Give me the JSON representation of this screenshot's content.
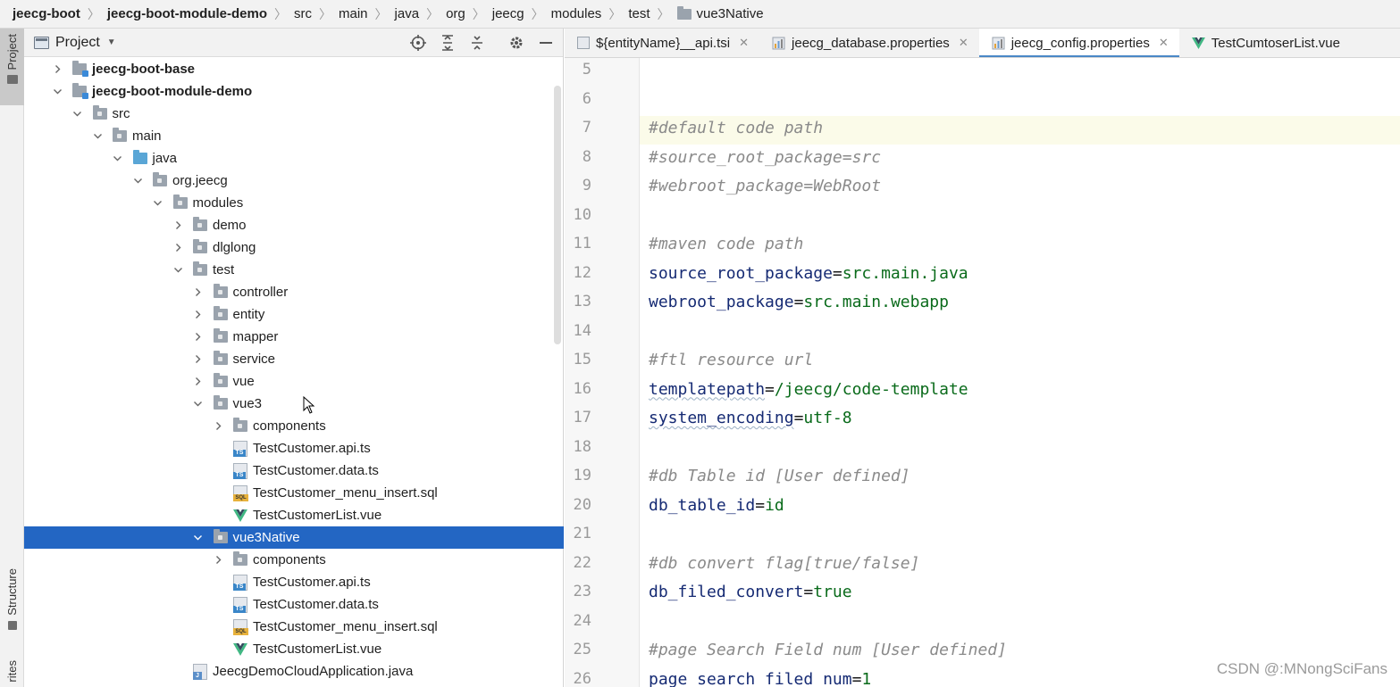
{
  "breadcrumb": [
    {
      "label": "jeecg-boot",
      "bold": true
    },
    {
      "label": "jeecg-boot-module-demo",
      "bold": true
    },
    {
      "label": "src"
    },
    {
      "label": "main"
    },
    {
      "label": "java"
    },
    {
      "label": "org"
    },
    {
      "label": "jeecg"
    },
    {
      "label": "modules"
    },
    {
      "label": "test"
    },
    {
      "label": "vue3Native",
      "folder": true
    }
  ],
  "tool_strip": {
    "project_label": "Project",
    "structure_label": "Structure",
    "favorites_label": "rites"
  },
  "project_panel": {
    "title": "Project",
    "tools": [
      "locate-icon",
      "expand-all-icon",
      "collapse-all-icon",
      "gear-icon",
      "minimize-icon"
    ]
  },
  "tree": [
    {
      "label": "jeecg-boot-base",
      "depth": 0,
      "chevron": "right",
      "icon": "module",
      "bold": true
    },
    {
      "label": "jeecg-boot-module-demo",
      "depth": 0,
      "chevron": "down",
      "icon": "module",
      "bold": true
    },
    {
      "label": "src",
      "depth": 1,
      "chevron": "down",
      "icon": "folder"
    },
    {
      "label": "main",
      "depth": 2,
      "chevron": "down",
      "icon": "folder"
    },
    {
      "label": "java",
      "depth": 3,
      "chevron": "down",
      "icon": "srcfolder"
    },
    {
      "label": "org.jeecg",
      "depth": 4,
      "chevron": "down",
      "icon": "folder"
    },
    {
      "label": "modules",
      "depth": 5,
      "chevron": "down",
      "icon": "folder"
    },
    {
      "label": "demo",
      "depth": 6,
      "chevron": "right",
      "icon": "folder"
    },
    {
      "label": "dlglong",
      "depth": 6,
      "chevron": "right",
      "icon": "folder"
    },
    {
      "label": "test",
      "depth": 6,
      "chevron": "down",
      "icon": "folder"
    },
    {
      "label": "controller",
      "depth": 7,
      "chevron": "right",
      "icon": "folder"
    },
    {
      "label": "entity",
      "depth": 7,
      "chevron": "right",
      "icon": "folder"
    },
    {
      "label": "mapper",
      "depth": 7,
      "chevron": "right",
      "icon": "folder"
    },
    {
      "label": "service",
      "depth": 7,
      "chevron": "right",
      "icon": "folder"
    },
    {
      "label": "vue",
      "depth": 7,
      "chevron": "right",
      "icon": "folder"
    },
    {
      "label": "vue3",
      "depth": 7,
      "chevron": "down",
      "icon": "folder"
    },
    {
      "label": "components",
      "depth": 8,
      "chevron": "right",
      "icon": "folder"
    },
    {
      "label": "TestCustomer.api.ts",
      "depth": 8,
      "chevron": "none",
      "icon": "ts"
    },
    {
      "label": "TestCustomer.data.ts",
      "depth": 8,
      "chevron": "none",
      "icon": "ts"
    },
    {
      "label": "TestCustomer_menu_insert.sql",
      "depth": 8,
      "chevron": "none",
      "icon": "sql"
    },
    {
      "label": "TestCustomerList.vue",
      "depth": 8,
      "chevron": "none",
      "icon": "vue"
    },
    {
      "label": "vue3Native",
      "depth": 7,
      "chevron": "down",
      "icon": "folder",
      "selected": true
    },
    {
      "label": "components",
      "depth": 8,
      "chevron": "right",
      "icon": "folder"
    },
    {
      "label": "TestCustomer.api.ts",
      "depth": 8,
      "chevron": "none",
      "icon": "ts"
    },
    {
      "label": "TestCustomer.data.ts",
      "depth": 8,
      "chevron": "none",
      "icon": "ts"
    },
    {
      "label": "TestCustomer_menu_insert.sql",
      "depth": 8,
      "chevron": "none",
      "icon": "sql"
    },
    {
      "label": "TestCustomerList.vue",
      "depth": 8,
      "chevron": "none",
      "icon": "vue"
    },
    {
      "label": "JeecgDemoCloudApplication.java",
      "depth": 6,
      "chevron": "none",
      "icon": "java"
    }
  ],
  "tabs": [
    {
      "label": "${entityName}__api.tsi",
      "icon": "tsi",
      "close": "✕"
    },
    {
      "label": "jeecg_database.properties",
      "icon": "prop",
      "close": "✕"
    },
    {
      "label": "jeecg_config.properties",
      "icon": "prop",
      "close": "✕",
      "active": true
    },
    {
      "label": "TestCumtoserList.vue",
      "icon": "vue",
      "close": "✕"
    }
  ],
  "code_lines": [
    {
      "num": "5",
      "parts": []
    },
    {
      "num": "6",
      "parts": []
    },
    {
      "num": "7",
      "parts": [
        {
          "t": "#default code path",
          "c": "comment"
        }
      ]
    },
    {
      "num": "8",
      "parts": [
        {
          "t": "#source_root_package=src",
          "c": "comment"
        }
      ]
    },
    {
      "num": "9",
      "parts": [
        {
          "t": "#webroot_package=WebRoot",
          "c": "comment"
        }
      ]
    },
    {
      "num": "10",
      "parts": []
    },
    {
      "num": "11",
      "parts": [
        {
          "t": "#maven code path",
          "c": "comment"
        }
      ]
    },
    {
      "num": "12",
      "parts": [
        {
          "t": "source_root_package",
          "c": "key"
        },
        {
          "t": "=",
          "c": "eq"
        },
        {
          "t": "src.main.java",
          "c": "val"
        }
      ]
    },
    {
      "num": "13",
      "parts": [
        {
          "t": "webroot_package",
          "c": "key"
        },
        {
          "t": "=",
          "c": "eq"
        },
        {
          "t": "src.main.webapp",
          "c": "val"
        }
      ]
    },
    {
      "num": "14",
      "parts": []
    },
    {
      "num": "15",
      "parts": [
        {
          "t": "#ftl resource url",
          "c": "comment"
        }
      ]
    },
    {
      "num": "16",
      "parts": [
        {
          "t": "templatepath",
          "c": "key wavy"
        },
        {
          "t": "=",
          "c": "eq"
        },
        {
          "t": "/jeecg/code-template",
          "c": "val"
        }
      ]
    },
    {
      "num": "17",
      "parts": [
        {
          "t": "system_encoding",
          "c": "key wavy"
        },
        {
          "t": "=",
          "c": "eq"
        },
        {
          "t": "utf-8",
          "c": "val"
        }
      ]
    },
    {
      "num": "18",
      "parts": []
    },
    {
      "num": "19",
      "parts": [
        {
          "t": "#db Table id [User defined]",
          "c": "comment"
        }
      ]
    },
    {
      "num": "20",
      "parts": [
        {
          "t": "db_table_id",
          "c": "key"
        },
        {
          "t": "=",
          "c": "eq"
        },
        {
          "t": "id",
          "c": "val"
        }
      ]
    },
    {
      "num": "21",
      "parts": []
    },
    {
      "num": "22",
      "parts": [
        {
          "t": "#db convert flag[true/false]",
          "c": "comment"
        }
      ]
    },
    {
      "num": "23",
      "parts": [
        {
          "t": "db_filed_convert",
          "c": "key"
        },
        {
          "t": "=",
          "c": "eq"
        },
        {
          "t": "true",
          "c": "val"
        }
      ]
    },
    {
      "num": "24",
      "parts": []
    },
    {
      "num": "25",
      "parts": [
        {
          "t": "#page Search Field num [User defined]",
          "c": "comment"
        }
      ]
    },
    {
      "num": "26",
      "parts": [
        {
          "t": "page_search_filed_num",
          "c": "key"
        },
        {
          "t": "=",
          "c": "eq"
        },
        {
          "t": "1",
          "c": "val"
        }
      ]
    }
  ],
  "watermark": "CSDN @:MNongSciFans"
}
